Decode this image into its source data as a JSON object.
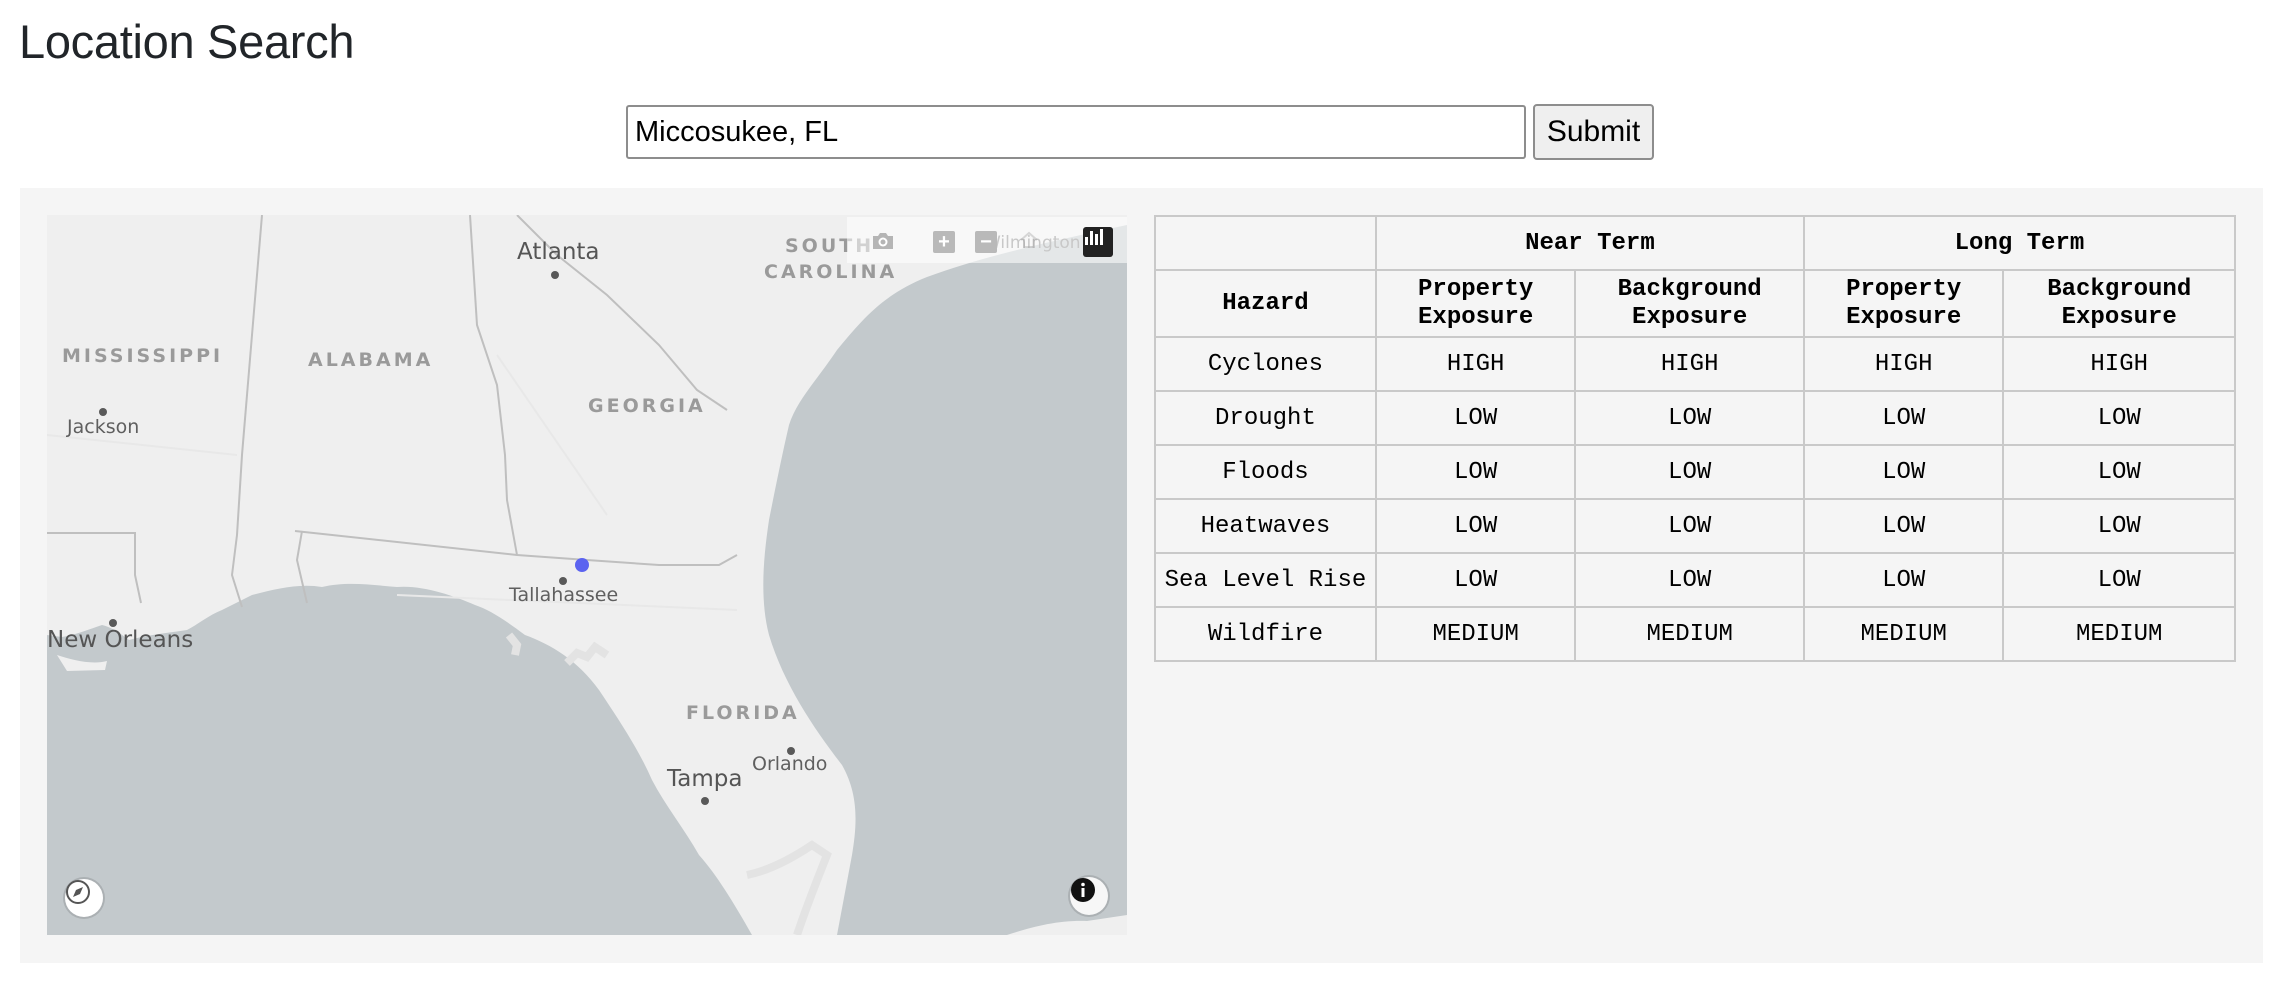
{
  "page": {
    "title": "Location Search"
  },
  "search": {
    "value": "Miccosukee, FL",
    "submit_label": "Submit"
  },
  "map": {
    "states": [
      "MISSISSIPPI",
      "ALABAMA",
      "GEORGIA",
      "SOUTH",
      "CAROLINA",
      "FLORIDA"
    ],
    "cities": [
      "Atlanta",
      "Jackson",
      "Tallahassee",
      "New Orleans",
      "Orlando",
      "Tampa",
      "Wilmington"
    ],
    "marker_color": "#5b63f0",
    "icons": {
      "camera": "camera-icon",
      "zoom_in": "zoom-in-icon",
      "zoom_out": "zoom-out-icon",
      "home": "home-icon",
      "logo": "plotly-logo-icon",
      "compass": "compass-icon",
      "info": "info-icon"
    }
  },
  "table": {
    "corner": "",
    "group_headers": [
      "Near Term",
      "Long Term"
    ],
    "hazard_header": "Hazard",
    "sub_headers": [
      "Property Exposure",
      "Background Exposure",
      "Property Exposure",
      "Background Exposure"
    ],
    "rows": [
      {
        "hazard": "Cyclones",
        "values": [
          "HIGH",
          "HIGH",
          "HIGH",
          "HIGH"
        ]
      },
      {
        "hazard": "Drought",
        "values": [
          "LOW",
          "LOW",
          "LOW",
          "LOW"
        ]
      },
      {
        "hazard": "Floods",
        "values": [
          "LOW",
          "LOW",
          "LOW",
          "LOW"
        ]
      },
      {
        "hazard": "Heatwaves",
        "values": [
          "LOW",
          "LOW",
          "LOW",
          "LOW"
        ]
      },
      {
        "hazard": "Sea Level Rise",
        "values": [
          "LOW",
          "LOW",
          "LOW",
          "LOW"
        ]
      },
      {
        "hazard": "Wildfire",
        "values": [
          "MEDIUM",
          "MEDIUM",
          "MEDIUM",
          "MEDIUM"
        ]
      }
    ]
  }
}
